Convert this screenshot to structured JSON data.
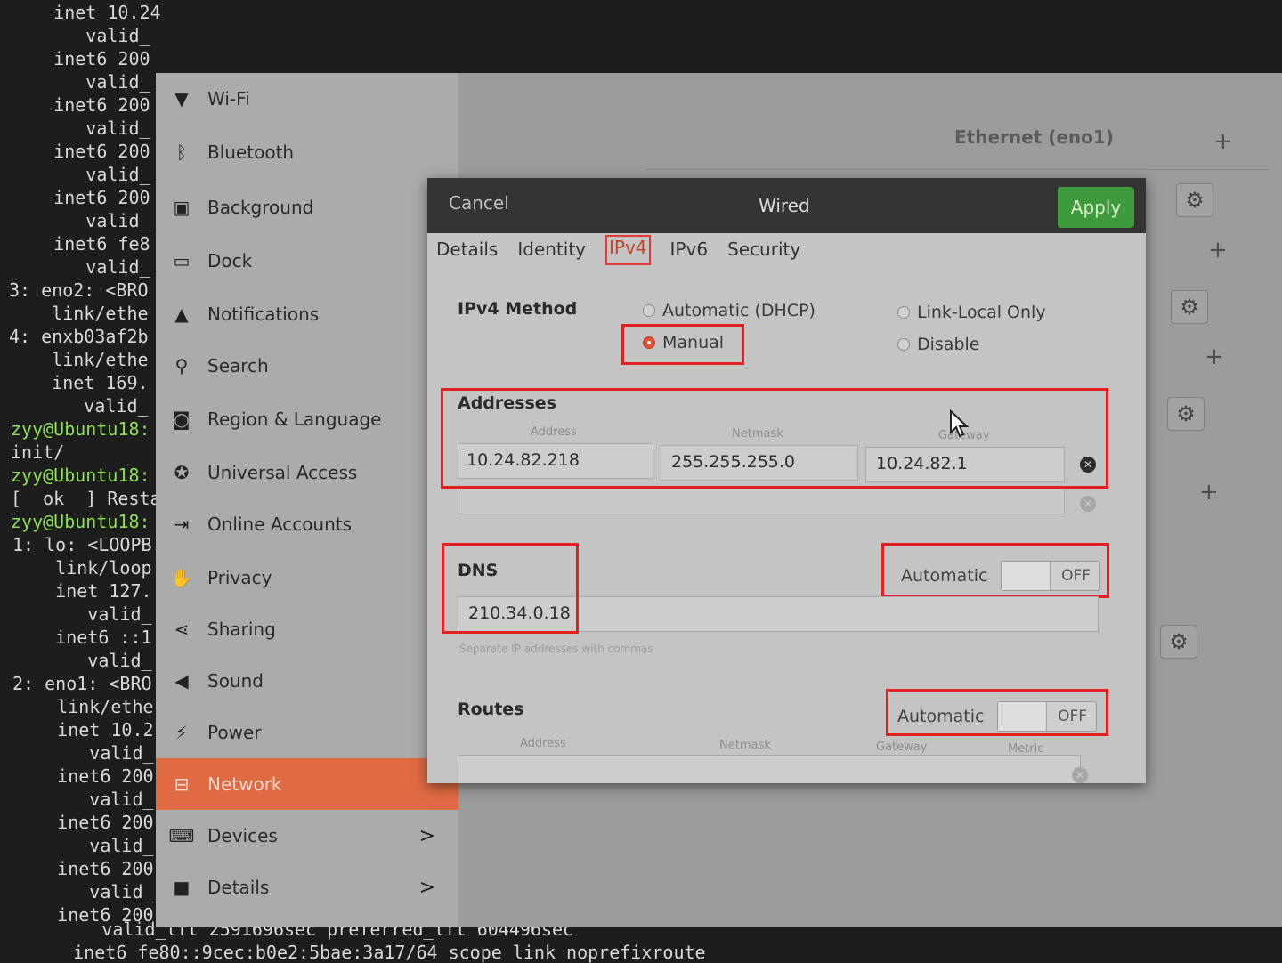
{
  "terminal": {
    "lines": [
      {
        "text": "    inet 10.24",
        "cls": ""
      },
      {
        "text": "       valid_",
        "cls": ""
      },
      {
        "text": "    inet6 200",
        "cls": ""
      },
      {
        "text": "       valid_",
        "cls": ""
      },
      {
        "text": "    inet6 200",
        "cls": ""
      },
      {
        "text": "       valid_",
        "cls": ""
      },
      {
        "text": "    inet6 200",
        "cls": ""
      },
      {
        "text": "       valid_",
        "cls": ""
      },
      {
        "text": "    inet6 200",
        "cls": ""
      },
      {
        "text": "       valid_",
        "cls": ""
      },
      {
        "text": "    inet6 fe8",
        "cls": ""
      },
      {
        "text": "       valid_",
        "cls": ""
      },
      {
        "text": "3: eno2: <BRO",
        "cls": ""
      },
      {
        "text": "    link/ethe",
        "cls": ""
      },
      {
        "text": "4: enxb03af2b",
        "cls": ""
      },
      {
        "text": "    link/ethe",
        "cls": ""
      },
      {
        "text": "    inet 169.",
        "cls": ""
      },
      {
        "text": "       valid_",
        "cls": ""
      },
      {
        "text": "zyy@Ubuntu18:",
        "cls": "green"
      },
      {
        "text": "init/",
        "cls": ""
      },
      {
        "text": "zyy@Ubuntu18:",
        "cls": "green"
      },
      {
        "text": "[  ok  ] Resta",
        "cls": ""
      },
      {
        "text": "zyy@Ubuntu18:",
        "cls": "green"
      },
      {
        "text": "1: lo: <LOOPB",
        "cls": ""
      },
      {
        "text": "    link/loop",
        "cls": ""
      },
      {
        "text": "    inet 127.",
        "cls": ""
      },
      {
        "text": "       valid_",
        "cls": ""
      },
      {
        "text": "    inet6 ::1",
        "cls": ""
      },
      {
        "text": "       valid_",
        "cls": ""
      },
      {
        "text": "2: eno1: <BRO",
        "cls": ""
      },
      {
        "text": "    link/ethe",
        "cls": ""
      },
      {
        "text": "    inet 10.2",
        "cls": ""
      },
      {
        "text": "       valid_",
        "cls": ""
      },
      {
        "text": "    inet6 200",
        "cls": ""
      },
      {
        "text": "       valid_",
        "cls": ""
      },
      {
        "text": "    inet6 200",
        "cls": ""
      },
      {
        "text": "       valid_",
        "cls": ""
      },
      {
        "text": "    inet6 200",
        "cls": ""
      },
      {
        "text": "       valid_",
        "cls": ""
      },
      {
        "text": "    inet6 200",
        "cls": ""
      },
      {
        "text": "       valid_lft 2591696sec preferred_lft 604496sec",
        "cls": ""
      },
      {
        "text": "    inet6 fe80::9cec:b0e2:5bae:3a17/64 scope link noprefixroute",
        "cls": ""
      }
    ]
  },
  "sidebar": {
    "items": [
      {
        "label": "Wi-Fi",
        "icon": "wifi-icon",
        "glyph": "▼"
      },
      {
        "label": "Bluetooth",
        "icon": "bluetooth-icon",
        "glyph": "ᛒ"
      },
      {
        "label": "Background",
        "icon": "background-icon",
        "glyph": "▣"
      },
      {
        "label": "Dock",
        "icon": "dock-icon",
        "glyph": "▭"
      },
      {
        "label": "Notifications",
        "icon": "bell-icon",
        "glyph": "▲"
      },
      {
        "label": "Search",
        "icon": "search-icon",
        "glyph": "⚲"
      },
      {
        "label": "Region & Language",
        "icon": "camera-icon",
        "glyph": "◙"
      },
      {
        "label": "Universal Access",
        "icon": "accessibility-icon",
        "glyph": "✪"
      },
      {
        "label": "Online Accounts",
        "icon": "online-accounts-icon",
        "glyph": "⇥"
      },
      {
        "label": "Privacy",
        "icon": "hand-icon",
        "glyph": "✋"
      },
      {
        "label": "Sharing",
        "icon": "share-icon",
        "glyph": "⋖"
      },
      {
        "label": "Sound",
        "icon": "speaker-icon",
        "glyph": "◀"
      },
      {
        "label": "Power",
        "icon": "power-icon",
        "glyph": "⚡"
      },
      {
        "label": "Network",
        "icon": "network-icon",
        "glyph": "⊟",
        "active": true
      },
      {
        "label": "Devices",
        "icon": "devices-icon",
        "glyph": "⌨",
        "chevron": ">"
      },
      {
        "label": "Details",
        "icon": "details-icon",
        "glyph": "■",
        "chevron": ">"
      }
    ]
  },
  "panel": {
    "title": "Ethernet (eno1)",
    "plus": "+",
    "gear": "⚙"
  },
  "dialog": {
    "cancel": "Cancel",
    "title": "Wired",
    "apply": "Apply",
    "tabs": [
      "Details",
      "Identity",
      "IPv4",
      "IPv6",
      "Security"
    ],
    "active_tab": "IPv4",
    "ipv4_method": {
      "label": "IPv4 Method",
      "options": [
        "Automatic (DHCP)",
        "Manual",
        "Link-Local Only",
        "Disable"
      ],
      "selected": "Manual"
    },
    "addresses": {
      "label": "Addresses",
      "columns": [
        "Address",
        "Netmask",
        "Gateway"
      ],
      "row": {
        "address": "10.24.82.218",
        "netmask": "255.255.255.0",
        "gateway": "10.24.82.1"
      },
      "remove_glyph": "✕"
    },
    "dns": {
      "label": "DNS",
      "automatic_label": "Automatic",
      "automatic_state": "OFF",
      "value": "210.34.0.18",
      "hint": "Separate IP addresses with commas"
    },
    "routes": {
      "label": "Routes",
      "automatic_label": "Automatic",
      "automatic_state": "OFF",
      "columns": [
        "Address",
        "Netmask",
        "Gateway",
        "Metric"
      ]
    }
  }
}
